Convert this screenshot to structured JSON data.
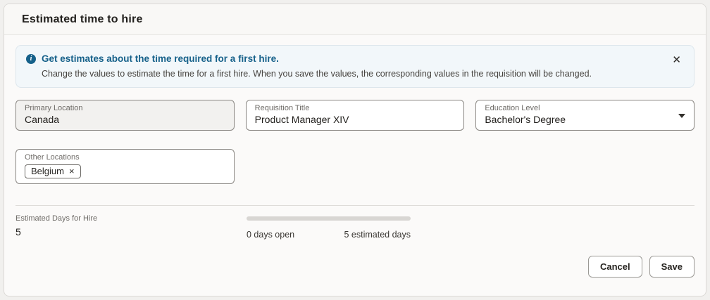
{
  "panel": {
    "title": "Estimated time to hire"
  },
  "icons": {
    "info": "i",
    "close": "✕",
    "chip_remove": "×",
    "caret": "dropdown-caret"
  },
  "banner": {
    "heading": "Get estimates about the time required for a first hire.",
    "description": "Change the values to estimate the time for a first hire. When you save the values, the corresponding values in the requisition will be changed."
  },
  "fields": {
    "primary_location": {
      "label": "Primary Location",
      "value": "Canada",
      "readonly": true
    },
    "requisition_title": {
      "label": "Requisition Title",
      "value": "Product Manager XIV"
    },
    "education_level": {
      "label": "Education Level",
      "value": "Bachelor's Degree"
    },
    "other_locations": {
      "label": "Other Locations",
      "chips": [
        {
          "label": "Belgium"
        }
      ]
    }
  },
  "estimate": {
    "label": "Estimated Days for Hire",
    "value": "5",
    "progress": {
      "percent": 0,
      "left_label": "0 days open",
      "right_label": "5 estimated days"
    }
  },
  "actions": {
    "cancel_label": "Cancel",
    "save_label": "Save"
  },
  "colors": {
    "accent_blue": "#16618a",
    "banner_bg": "#f2f7fa",
    "banner_border": "#dde6ec",
    "panel_bg": "#fbfaf9",
    "readonly_field_bg": "#f2f1ef",
    "progress_track": "#d8d6d3"
  }
}
